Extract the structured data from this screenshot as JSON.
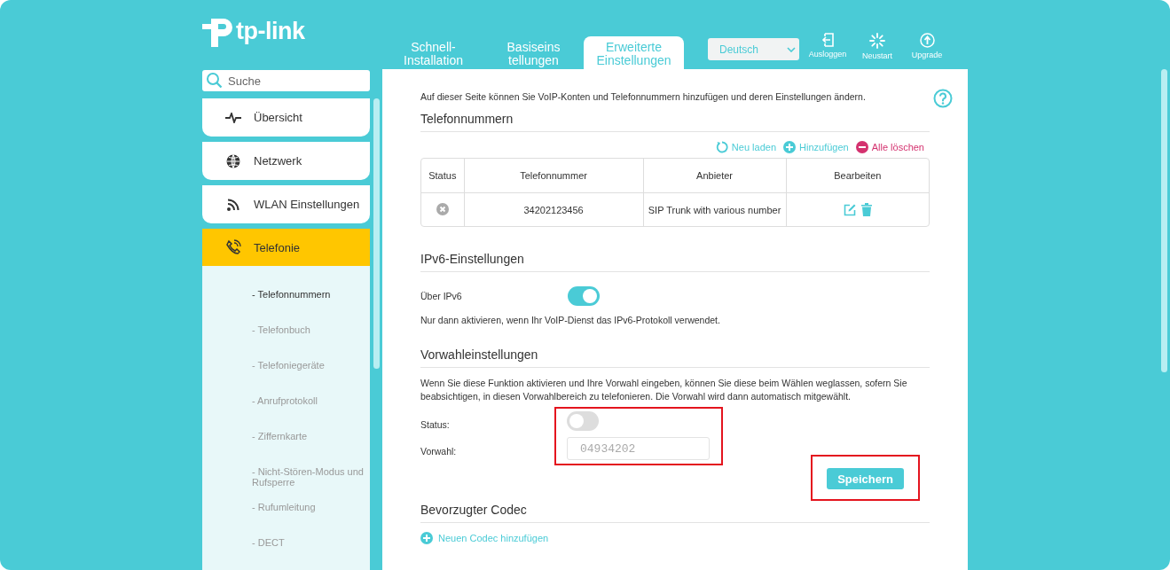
{
  "logo": {
    "text": "tp-link"
  },
  "tabs": [
    {
      "label": "Schnell-\nInstallation",
      "selected": false
    },
    {
      "label": "Basiseins\ntellungen",
      "selected": false
    },
    {
      "label": "Erweiterte\nEinstellungen",
      "selected": true
    }
  ],
  "language": {
    "value": "Deutsch"
  },
  "top_actions": [
    {
      "kind": "logout",
      "label": "Ausloggen"
    },
    {
      "kind": "restart",
      "label": "Neustart"
    },
    {
      "kind": "upgrade",
      "label": "Upgrade"
    }
  ],
  "search": {
    "placeholder": "Suche"
  },
  "sidebar": {
    "items": [
      {
        "kind": "pulse",
        "label": "Übersicht",
        "selected": false
      },
      {
        "kind": "globe",
        "label": "Netzwerk",
        "selected": false
      },
      {
        "kind": "wifi",
        "label": "WLAN Einstellungen",
        "selected": false
      },
      {
        "kind": "phone",
        "label": "Telefonie",
        "selected": true,
        "children": [
          {
            "label": "- Telefonnummern",
            "selected": true
          },
          {
            "label": "- Telefonbuch",
            "selected": false
          },
          {
            "label": "- Telefoniegeräte",
            "selected": false
          },
          {
            "label": "- Anrufprotokoll",
            "selected": false
          },
          {
            "label": "- Ziffernkarte",
            "selected": false
          },
          {
            "label": "- Nicht-Stören-Modus und\nRufsperre",
            "selected": false
          },
          {
            "label": "- Rufumleitung",
            "selected": false
          },
          {
            "label": "- DECT",
            "selected": false
          }
        ]
      }
    ]
  },
  "intro": "Auf dieser Seite können Sie VoIP-Konten und Telefonnummern hinzufügen und deren Einstellungen ändern.",
  "phone_numbers": {
    "title": "Telefonnummern",
    "actions": [
      {
        "kind": "reload",
        "label": "Neu laden"
      },
      {
        "kind": "add",
        "label": "Hinzufügen"
      },
      {
        "kind": "delete",
        "label": "Alle löschen"
      }
    ],
    "columns": [
      "Status",
      "Telefonnummer",
      "Anbieter",
      "Bearbeiten"
    ],
    "rows": [
      {
        "active": false,
        "number": "34202123456",
        "provider": "SIP Trunk with various number"
      }
    ]
  },
  "ipv6": {
    "title": "IPv6-Einstellungen",
    "label": "Über IPv6",
    "on": true,
    "note": "Nur dann aktivieren, wenn Ihr VoIP-Dienst das IPv6-Protokoll verwendet."
  },
  "prefix": {
    "title": "Vorwahleinstellungen",
    "description": "Wenn Sie diese Funktion aktivieren und Ihre Vorwahl eingeben, können Sie diese beim Wählen weglassen, sofern Sie beabsichtigen, in diesen Vorwahlbereich zu telefonieren. Die Vorwahl wird dann automatisch mitgewählt.",
    "status_label": "Status:",
    "on": false,
    "prefix_label": "Vorwahl:",
    "placeholder": "04934202",
    "highlighted": true
  },
  "save_button": {
    "label": "Speichern",
    "highlighted": true
  },
  "codec": {
    "title": "Bevorzugter Codec",
    "add_label": "Neuen Codec hinzufügen"
  }
}
